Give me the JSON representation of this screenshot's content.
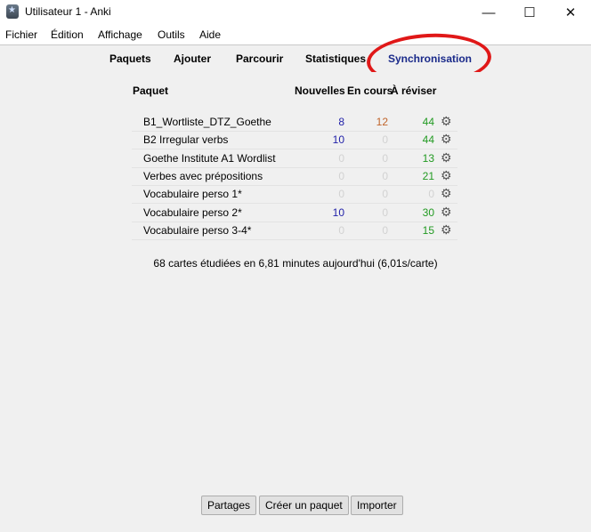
{
  "window": {
    "title": "Utilisateur 1 - Anki",
    "minimize": "—",
    "maximize": "☐",
    "close": "✕"
  },
  "menu": [
    "Fichier",
    "Édition",
    "Affichage",
    "Outils",
    "Aide"
  ],
  "toolbar": [
    "Paquets",
    "Ajouter",
    "Parcourir",
    "Statistiques",
    "Synchronisation"
  ],
  "table_headers": {
    "deck": "Paquet",
    "new": "Nouvelles",
    "learning": "En cours",
    "review": "À réviser"
  },
  "decks": [
    {
      "name": "B1_Wortliste_DTZ_Goethe",
      "new": "8",
      "learning": "12",
      "review": "44"
    },
    {
      "name": "B2 Irregular verbs",
      "new": "10",
      "learning": "0",
      "review": "44"
    },
    {
      "name": "Goethe Institute A1 Wordlist",
      "new": "0",
      "learning": "0",
      "review": "13"
    },
    {
      "name": "Verbes avec prépositions",
      "new": "0",
      "learning": "0",
      "review": "21"
    },
    {
      "name": "Vocabulaire perso 1*",
      "new": "0",
      "learning": "0",
      "review": "0"
    },
    {
      "name": "Vocabulaire perso 2*",
      "new": "10",
      "learning": "0",
      "review": "30"
    },
    {
      "name": "Vocabulaire perso 3-4*",
      "new": "0",
      "learning": "0",
      "review": "15"
    }
  ],
  "summary": "68 cartes étudiées en 6,81 minutes aujourd'hui (6,01s/carte)",
  "buttons": {
    "shared": "Partages",
    "create": "Créer un paquet",
    "import": "Importer"
  },
  "colors": {
    "new": "#1f1fa8",
    "learning": "#c0642a",
    "review": "#229a22",
    "zero": "#d2d2d2",
    "highlight": "#e01818"
  }
}
